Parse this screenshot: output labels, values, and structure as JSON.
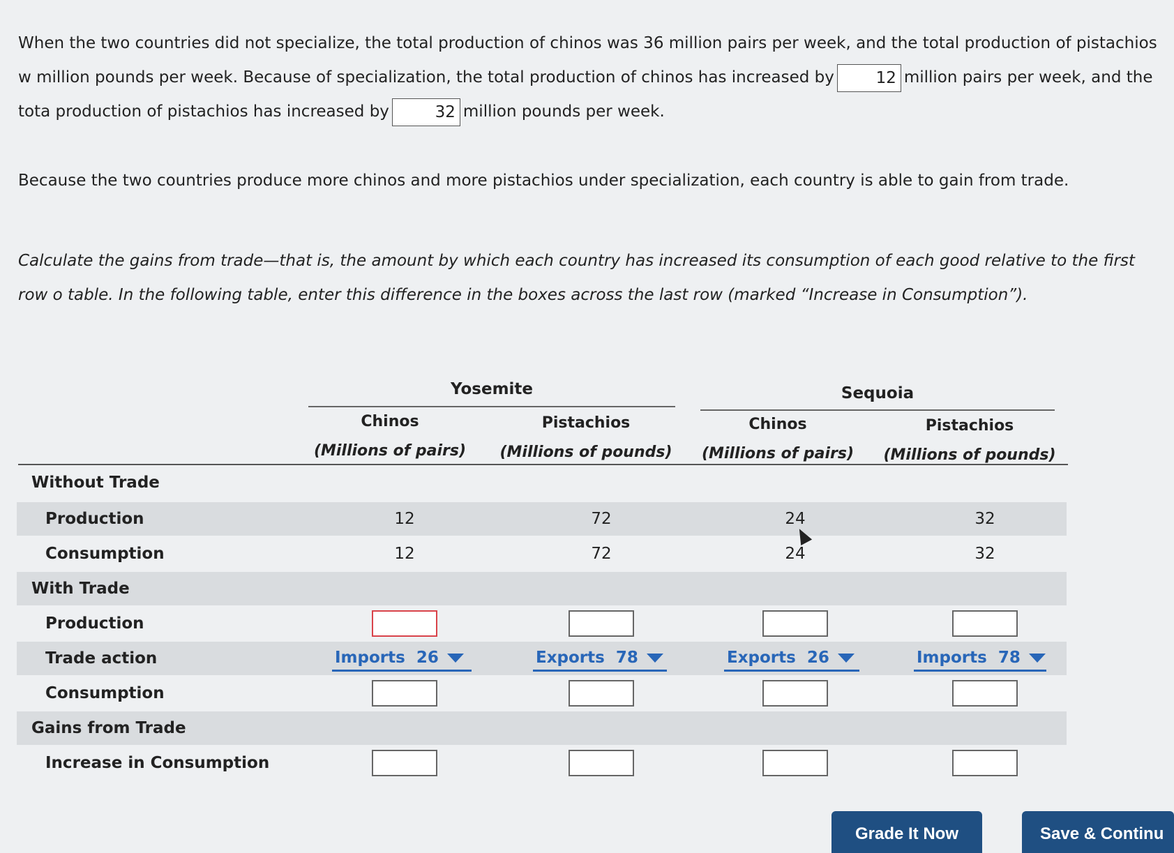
{
  "paragraphs": {
    "p1_part1": "When the two countries did not specialize, the total production of chinos was 36 million pairs per week, and the total production of pistachios w",
    "p1_part2": "million pounds per week. Because of specialization, the total production of chinos has increased by",
    "p1_part3": "million pairs per week, and the tota",
    "p1_part4": "production of pistachios has increased by",
    "p1_part5": "million pounds per week.",
    "chinos_increase_value": "12",
    "pistachios_increase_value": "32",
    "p2": "Because the two countries produce more chinos and more pistachios under specialization, each country is able to gain from trade.",
    "p3": "Calculate the gains from trade—that is, the amount by which each country has increased its consumption of each good relative to the first row o table. In the following table, enter this difference in the boxes across the last row (marked “Increase in Consumption”)."
  },
  "table": {
    "groups": [
      "Yosemite",
      "Sequoia"
    ],
    "columns": [
      {
        "name": "Chinos",
        "unit": "(Millions of pairs)"
      },
      {
        "name": "Pistachios",
        "unit": "(Millions of pounds)"
      },
      {
        "name": "Chinos",
        "unit": "(Millions of pairs)"
      },
      {
        "name": "Pistachios",
        "unit": "(Millions of pounds)"
      }
    ],
    "sections": {
      "without_trade": "Without Trade",
      "with_trade": "With Trade",
      "gains": "Gains from Trade"
    },
    "rows": {
      "production": {
        "label": "Production",
        "values": [
          "12",
          "72",
          "24",
          "32"
        ]
      },
      "consumption": {
        "label": "Consumption",
        "values": [
          "12",
          "72",
          "24",
          "32"
        ]
      },
      "wt_production": {
        "label": "Production"
      },
      "trade_action": {
        "label": "Trade action",
        "values": [
          "Imports  26",
          "Exports  78",
          "Exports  26",
          "Imports  78"
        ]
      },
      "wt_consumption": {
        "label": "Consumption"
      },
      "increase": {
        "label": "Increase in Consumption"
      }
    }
  },
  "buttons": {
    "grade": "Grade It Now",
    "save": "Save & Continu"
  },
  "colors": {
    "accent": "#2866b8",
    "button": "#1f4f82",
    "error": "#d9434a",
    "shade": "#d9dcdf"
  }
}
